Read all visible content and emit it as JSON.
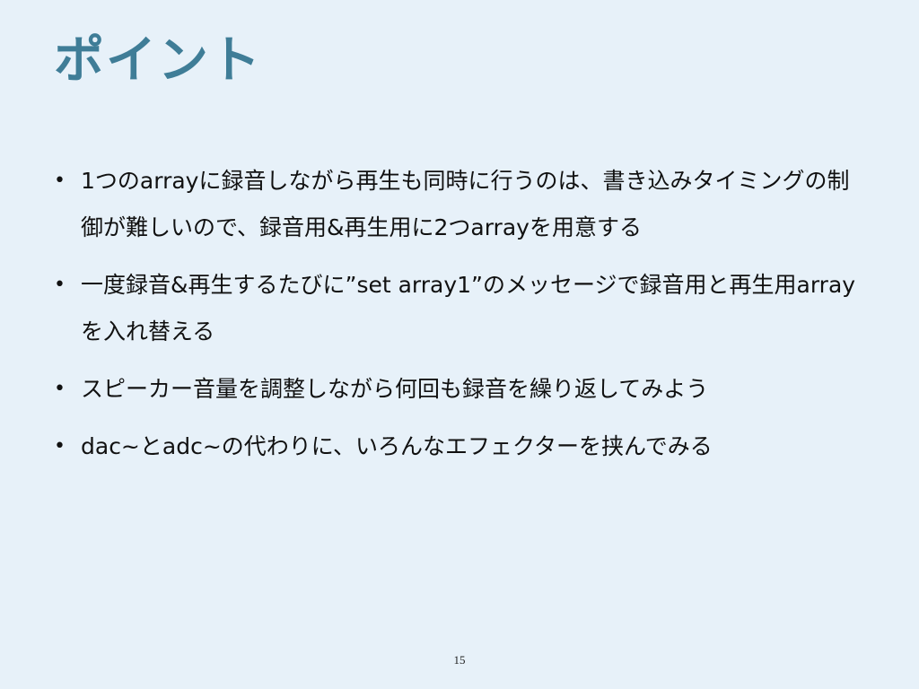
{
  "slide": {
    "title": "ポイント",
    "bullets": [
      "1つのarrayに録音しながら再生も同時に行うのは、書き込みタイミングの制御が難しいので、録音用&再生用に2つarrayを用意する",
      "一度録音&再生するたびに”set array1”のメッセージで録音用と再生用arrayを入れ替える",
      "スピーカー音量を調整しながら何回も録音を繰り返してみよう",
      "dac~とadc~の代わりに、いろんなエフェクターを挟んでみる"
    ],
    "bullet_marker": "•",
    "page_number": "15"
  }
}
